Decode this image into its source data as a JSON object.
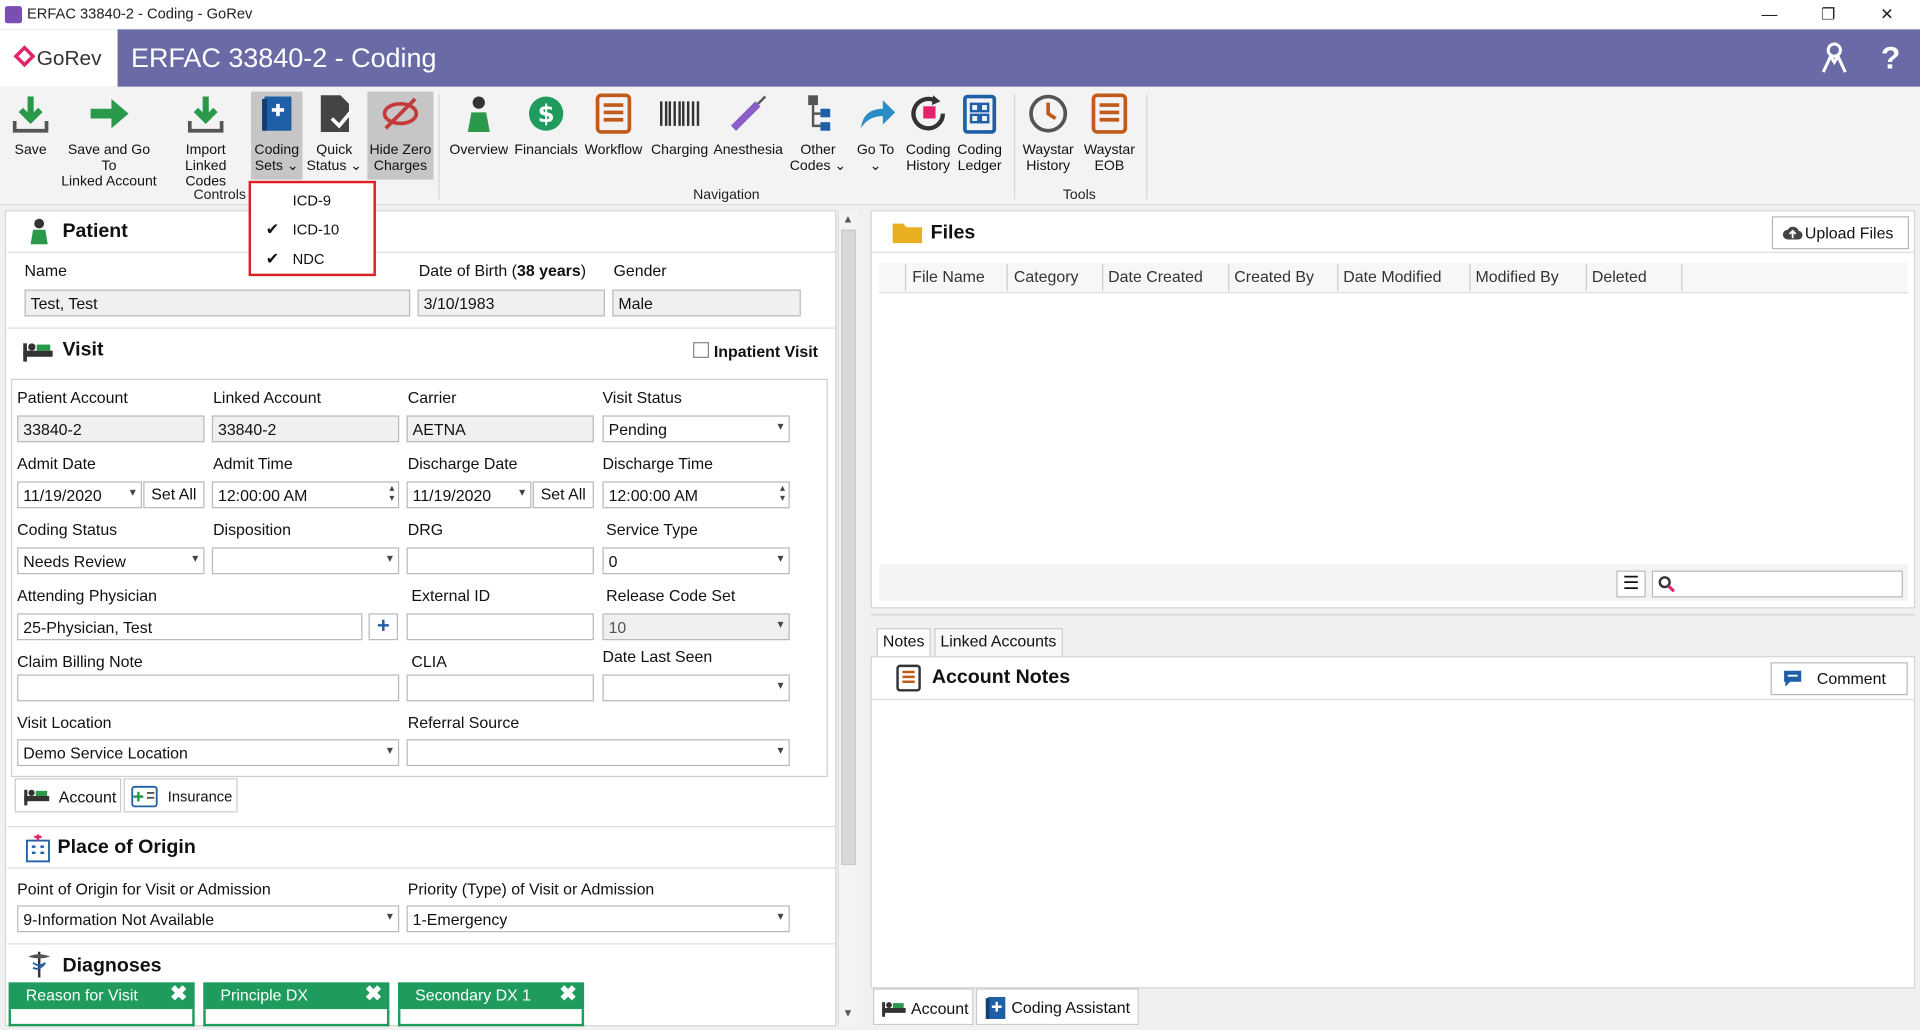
{
  "window": {
    "title": "ERFAC 33840-2 - Coding - GoRev",
    "minimize": "—",
    "restore": "❐",
    "close": "✕"
  },
  "header": {
    "brand": "GoRev",
    "title": "ERFAC 33840-2 - Coding"
  },
  "ribbon": {
    "save": "Save",
    "save_go_1": "Save and Go To",
    "save_go_2": "Linked Account",
    "import_1": "Import",
    "import_2": "Linked Codes",
    "coding_sets_1": "Coding",
    "coding_sets_2": "Sets ⌄",
    "quick_status_1": "Quick",
    "quick_status_2": "Status ⌄",
    "hide_zero_1": "Hide Zero",
    "hide_zero_2": "Charges",
    "controls": "Controls",
    "overview": "Overview",
    "financials": "Financials",
    "workflow": "Workflow",
    "charging": "Charging",
    "anesthesia": "Anesthesia",
    "other_codes_1": "Other",
    "other_codes_2": "Codes ⌄",
    "goto_1": "Go To",
    "goto_2": "⌄",
    "coding_history_1": "Coding",
    "coding_history_2": "History",
    "coding_ledger_1": "Coding",
    "coding_ledger_2": "Ledger",
    "navigation": "Navigation",
    "waystar_history_1": "Waystar",
    "waystar_history_2": "History",
    "waystar_eob_1": "Waystar",
    "waystar_eob_2": "EOB",
    "tools": "Tools"
  },
  "coding_sets_menu": {
    "items": [
      {
        "label": "ICD-9",
        "checked": false
      },
      {
        "label": "ICD-10",
        "checked": true
      },
      {
        "label": "NDC",
        "checked": true
      }
    ],
    "check": "✔"
  },
  "patient": {
    "heading": "Patient",
    "name_label": "Name",
    "name": "Test, Test",
    "dob_label": "Date of Birth (",
    "dob_years": "38 years",
    "dob_close": ")",
    "dob": "3/10/1983",
    "gender_label": "Gender",
    "gender": "Male"
  },
  "visit": {
    "heading": "Visit",
    "inpatient_label": "Inpatient Visit",
    "patient_account_label": "Patient Account",
    "patient_account": "33840-2",
    "linked_account_label": "Linked Account",
    "linked_account": "33840-2",
    "carrier_label": "Carrier",
    "carrier": "AETNA",
    "visit_status_label": "Visit Status",
    "visit_status": "Pending",
    "admit_date_label": "Admit Date",
    "admit_date": "11/19/2020",
    "set_all": "Set All",
    "admit_time_label": "Admit Time",
    "admit_time": "12:00:00 AM",
    "discharge_date_label": "Discharge Date",
    "discharge_date": "11/19/2020",
    "discharge_time_label": "Discharge Time",
    "discharge_time": "12:00:00 AM",
    "coding_status_label": "Coding Status",
    "coding_status": "Needs Review",
    "disposition_label": "Disposition",
    "disposition": "",
    "drg_label": "DRG",
    "drg": "",
    "service_type_label": "Service Type",
    "service_type": "0",
    "attending_label": "Attending Physician",
    "attending": "25-Physician, Test",
    "external_id_label": "External ID",
    "external_id": "",
    "release_code_label": "Release Code Set",
    "release_code": "10",
    "claim_note_label": "Claim Billing Note",
    "clia_label": "CLIA",
    "date_last_seen_label": "Date Last Seen",
    "visit_location_label": "Visit Location",
    "visit_location": "Demo Service Location",
    "referral_label": "Referral Source",
    "referral": "",
    "tab_account": "Account",
    "tab_insurance": "Insurance"
  },
  "origin": {
    "heading": "Place of Origin",
    "point_label": "Point of Origin for Visit or Admission",
    "point": "9-Information Not Available",
    "priority_label": "Priority (Type) of Visit or Admission",
    "priority": "1-Emergency"
  },
  "diagnoses": {
    "heading": "Diagnoses",
    "tabs": [
      "Reason for Visit",
      "Principle DX",
      "Secondary DX 1"
    ],
    "close": "✖"
  },
  "files": {
    "heading": "Files",
    "upload": "Upload Files",
    "columns": [
      "File Name",
      "Category",
      "Date Created",
      "Created By",
      "Date Modified",
      "Modified By",
      "Deleted"
    ],
    "search_placeholder": ""
  },
  "notes": {
    "tab_notes": "Notes",
    "tab_linked": "Linked Accounts",
    "heading": "Account Notes",
    "comment": "Comment"
  },
  "bottom_tabs": {
    "account": "Account",
    "coding_assistant": "Coding Assistant"
  },
  "colors": {
    "header": "#6a6aa6",
    "accent_green": "#1e9b5d",
    "menu_border": "#e02020",
    "brand_pink": "#e0246c"
  }
}
